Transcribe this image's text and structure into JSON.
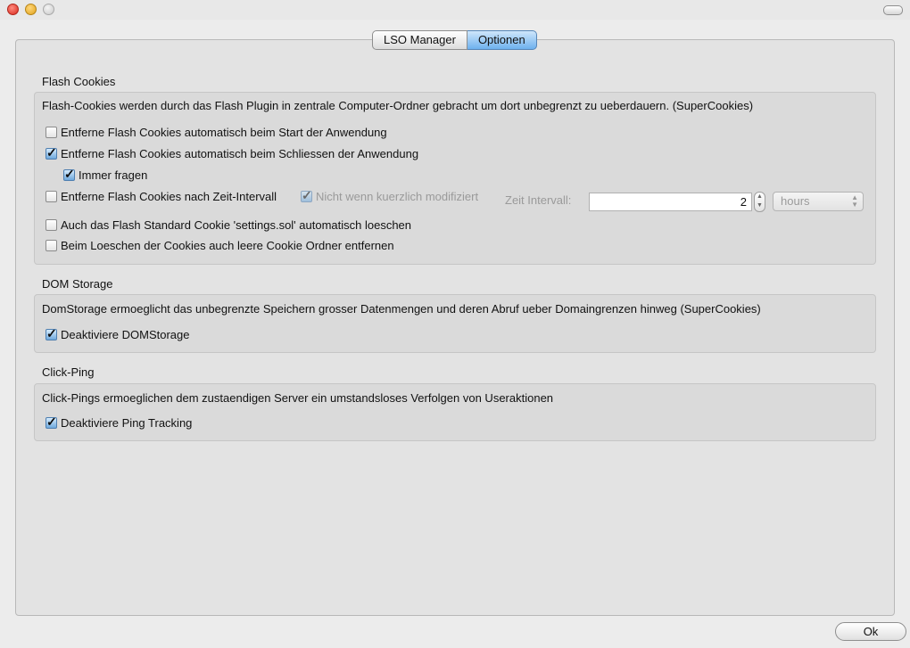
{
  "tabs": [
    "LSO Manager",
    "Optionen"
  ],
  "selected_tab": "Optionen",
  "flash": {
    "title": "Flash Cookies",
    "description": "Flash-Cookies werden durch das Flash Plugin in zentrale Computer-Ordner gebracht um dort unbegrenzt zu ueberdauern. (SuperCookies)",
    "opt_start": {
      "label": "Entferne Flash Cookies automatisch beim Start der Anwendung",
      "checked": false
    },
    "opt_close": {
      "label": "Entferne Flash Cookies automatisch beim Schliessen der Anwendung",
      "checked": true
    },
    "opt_ask": {
      "label": "Immer fragen",
      "checked": true
    },
    "opt_interval": {
      "label": "Entferne Flash Cookies nach Zeit-Intervall",
      "checked": false
    },
    "opt_not_recent": {
      "label": "Nicht wenn kuerzlich modifiziert",
      "checked": true,
      "enabled": false
    },
    "interval_label": "Zeit Intervall:",
    "interval_value": "2",
    "unit": "hours",
    "opt_settings_sol": {
      "label": "Auch das Flash Standard Cookie 'settings.sol' automatisch loeschen",
      "checked": false
    },
    "opt_empty_folders": {
      "label": "Beim Loeschen der Cookies auch leere Cookie Ordner entfernen",
      "checked": false
    }
  },
  "dom": {
    "title": "DOM Storage",
    "description": "DomStorage ermoeglicht das unbegrenzte Speichern grosser Datenmengen und deren Abruf ueber Domaingrenzen hinweg (SuperCookies)",
    "opt_disable": {
      "label": "Deaktiviere DOMStorage",
      "checked": true
    }
  },
  "ping": {
    "title": "Click-Ping",
    "description": "Click-Pings ermoeglichen dem zustaendigen Server ein umstandsloses Verfolgen von Useraktionen",
    "opt_disable": {
      "label": "Deaktiviere Ping Tracking",
      "checked": true
    }
  },
  "ok_label": "Ok"
}
